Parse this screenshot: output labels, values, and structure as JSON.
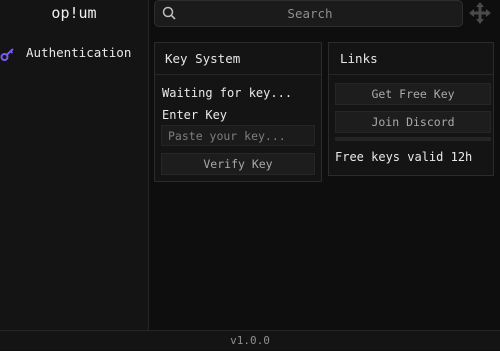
{
  "app": {
    "title": "op!um",
    "version": "v1.0.0",
    "accent": "#7a5cf0"
  },
  "sidebar": {
    "items": [
      {
        "label": "Authentication",
        "icon": "key-icon"
      }
    ]
  },
  "search": {
    "placeholder": "Search",
    "icon": "search-icon"
  },
  "window": {
    "move_icon": "move-icon"
  },
  "key_system": {
    "title": "Key System",
    "status": "Waiting for key...",
    "enter_key_label": "Enter Key",
    "key_input": {
      "value": "",
      "placeholder": "Paste your key..."
    },
    "verify_button": "Verify Key"
  },
  "links": {
    "title": "Links",
    "get_key_button": "Get Free Key",
    "discord_button": "Join Discord",
    "progress": 0,
    "note": "Free keys valid 12h"
  }
}
